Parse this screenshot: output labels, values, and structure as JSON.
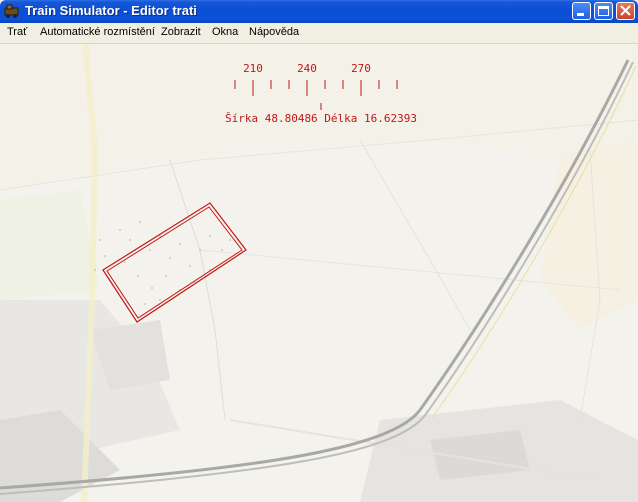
{
  "window": {
    "title": "Train Simulator - Editor trati"
  },
  "menu": [
    {
      "label": "Trať"
    },
    {
      "label": "Automatické rozmístění"
    },
    {
      "label": "Zobrazit"
    },
    {
      "label": "Okna"
    },
    {
      "label": "Nápověda"
    }
  ],
  "compass": {
    "labels": [
      "210",
      "240",
      "270"
    ],
    "coords": "Šírka 48.80486 Délka 16.62393"
  },
  "colors": {
    "accent": "#c01818",
    "titlebar": "#0a4fd6"
  }
}
